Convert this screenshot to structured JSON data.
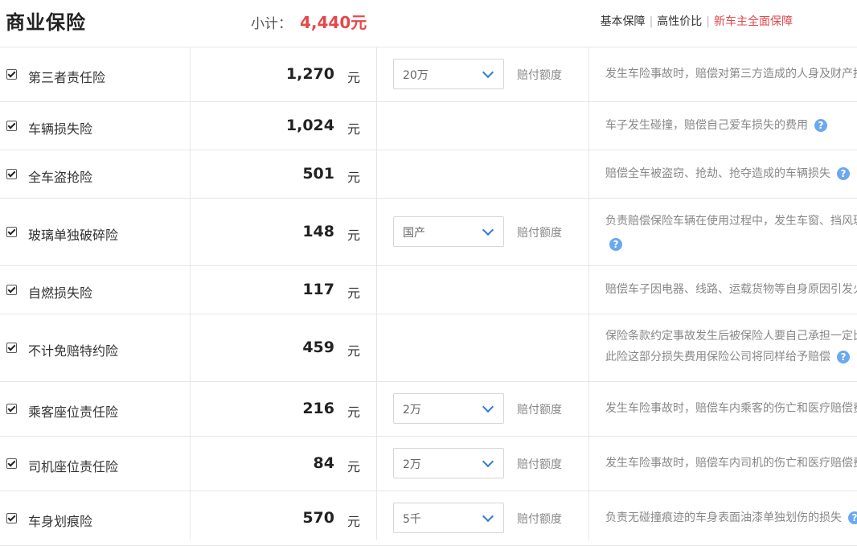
{
  "header": {
    "title": "商业保险",
    "subtotal_label": "小计：",
    "subtotal_value": "4,440元",
    "plans": [
      "基本保障",
      "高性价比",
      "新车主全面保障"
    ],
    "active_plan_index": 2
  },
  "unit_label": "元",
  "select_label": "赔付额度",
  "help_glyph": "?",
  "rows": [
    {
      "name": "第三者责任险",
      "price": "1,270",
      "select": "20万",
      "desc": "发生车险事故时，赔偿对第三方造成的人身及财产损失",
      "checked": true
    },
    {
      "name": "车辆损失险",
      "price": "1,024",
      "desc": "车子发生碰撞，赔偿自己爱车损失的费用",
      "checked": true
    },
    {
      "name": "全车盗抢险",
      "price": "501",
      "desc": "赔偿全车被盗窃、抢劫、抢夺造成的车辆损失",
      "checked": true
    },
    {
      "name": "玻璃单独破碎险",
      "price": "148",
      "select": "国产",
      "desc": "负责赔偿保险车辆在使用过程中，发生车窗、挡风玻",
      "checked": true
    },
    {
      "name": "自燃损失险",
      "price": "117",
      "desc": "赔偿车子因电器、线路、运载货物等自身原因引发火",
      "checked": true
    },
    {
      "name": "不计免赔特约险",
      "price": "459",
      "desc": "保险条款约定事故发生后被保险人要自己承担一定比",
      "desc2": "此险这部分损失费用保险公司将同样给予赔偿",
      "checked": true
    },
    {
      "name": "乘客座位责任险",
      "price": "216",
      "select": "2万",
      "desc": "发生车险事故时，赔偿车内乘客的伤亡和医疗赔偿费",
      "checked": true
    },
    {
      "name": "司机座位责任险",
      "price": "84",
      "select": "2万",
      "desc": "发生车险事故时，赔偿车内司机的伤亡和医疗赔偿费",
      "checked": true
    },
    {
      "name": "车身划痕险",
      "price": "570",
      "select": "5千",
      "desc": "负责无碰撞痕迹的车身表面油漆单独划伤的损失",
      "checked": true
    }
  ]
}
